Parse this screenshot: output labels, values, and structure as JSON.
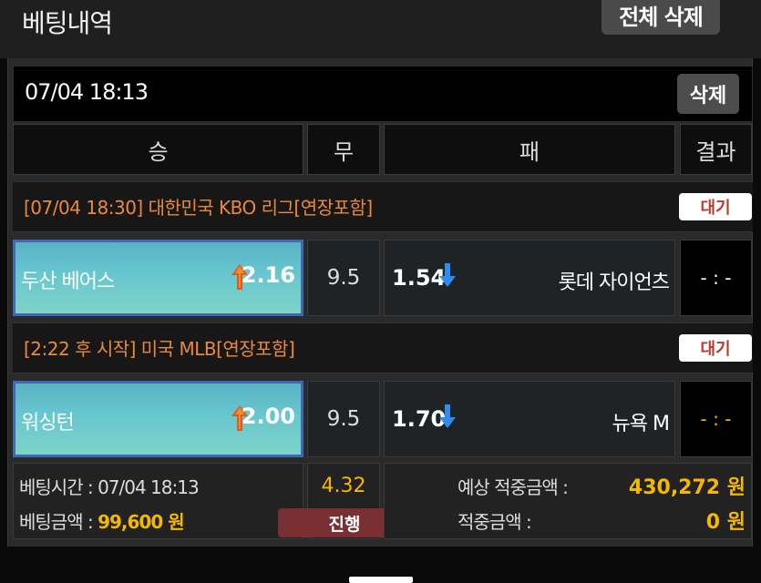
{
  "header": {
    "title": "베팅내역",
    "delete_all_label": "전체 삭제"
  },
  "bet": {
    "datetime": "07/04 18:13",
    "delete_label": "삭제",
    "columns": {
      "win": "승",
      "draw": "무",
      "lose": "패",
      "result": "결과"
    },
    "games": [
      {
        "league": "[07/04 18:30] 대한민국 KBO 리그[연장포함]",
        "status": "대기",
        "home_team": "두산 베어스",
        "home_odds": "2.16",
        "draw_odds": "9.5",
        "away_odds": "1.54",
        "away_team": "롯데 자이언츠",
        "score": "- : -",
        "score_color": "#ffffff"
      },
      {
        "league": "[2:22 후 시작] 미국 MLB[연장포함]",
        "status": "대기",
        "home_team": "워싱턴",
        "home_odds": "2.00",
        "draw_odds": "9.5",
        "away_odds": "1.70",
        "away_team": "뉴욕 M",
        "score": "- : -",
        "score_color": "#f5b800"
      }
    ],
    "summary": {
      "bet_time_label": "베팅시간 : ",
      "bet_time": "07/04 18:13",
      "bet_amount_label": "베팅금액 : ",
      "bet_amount": "99,600 원",
      "total_odds": "4.32",
      "progress_status": "진행",
      "expected_win_label": "예상 적중금액 :",
      "expected_win": "430,272 원",
      "win_amount_label": "적중금액 :",
      "win_amount": "0 원"
    }
  },
  "colors": {
    "accent_orange": "#e98a3b",
    "accent_yellow": "#f5b800",
    "status_red": "#c0392b",
    "up_arrow": "arrow-up-icon",
    "down_arrow": "arrow-down-icon"
  }
}
